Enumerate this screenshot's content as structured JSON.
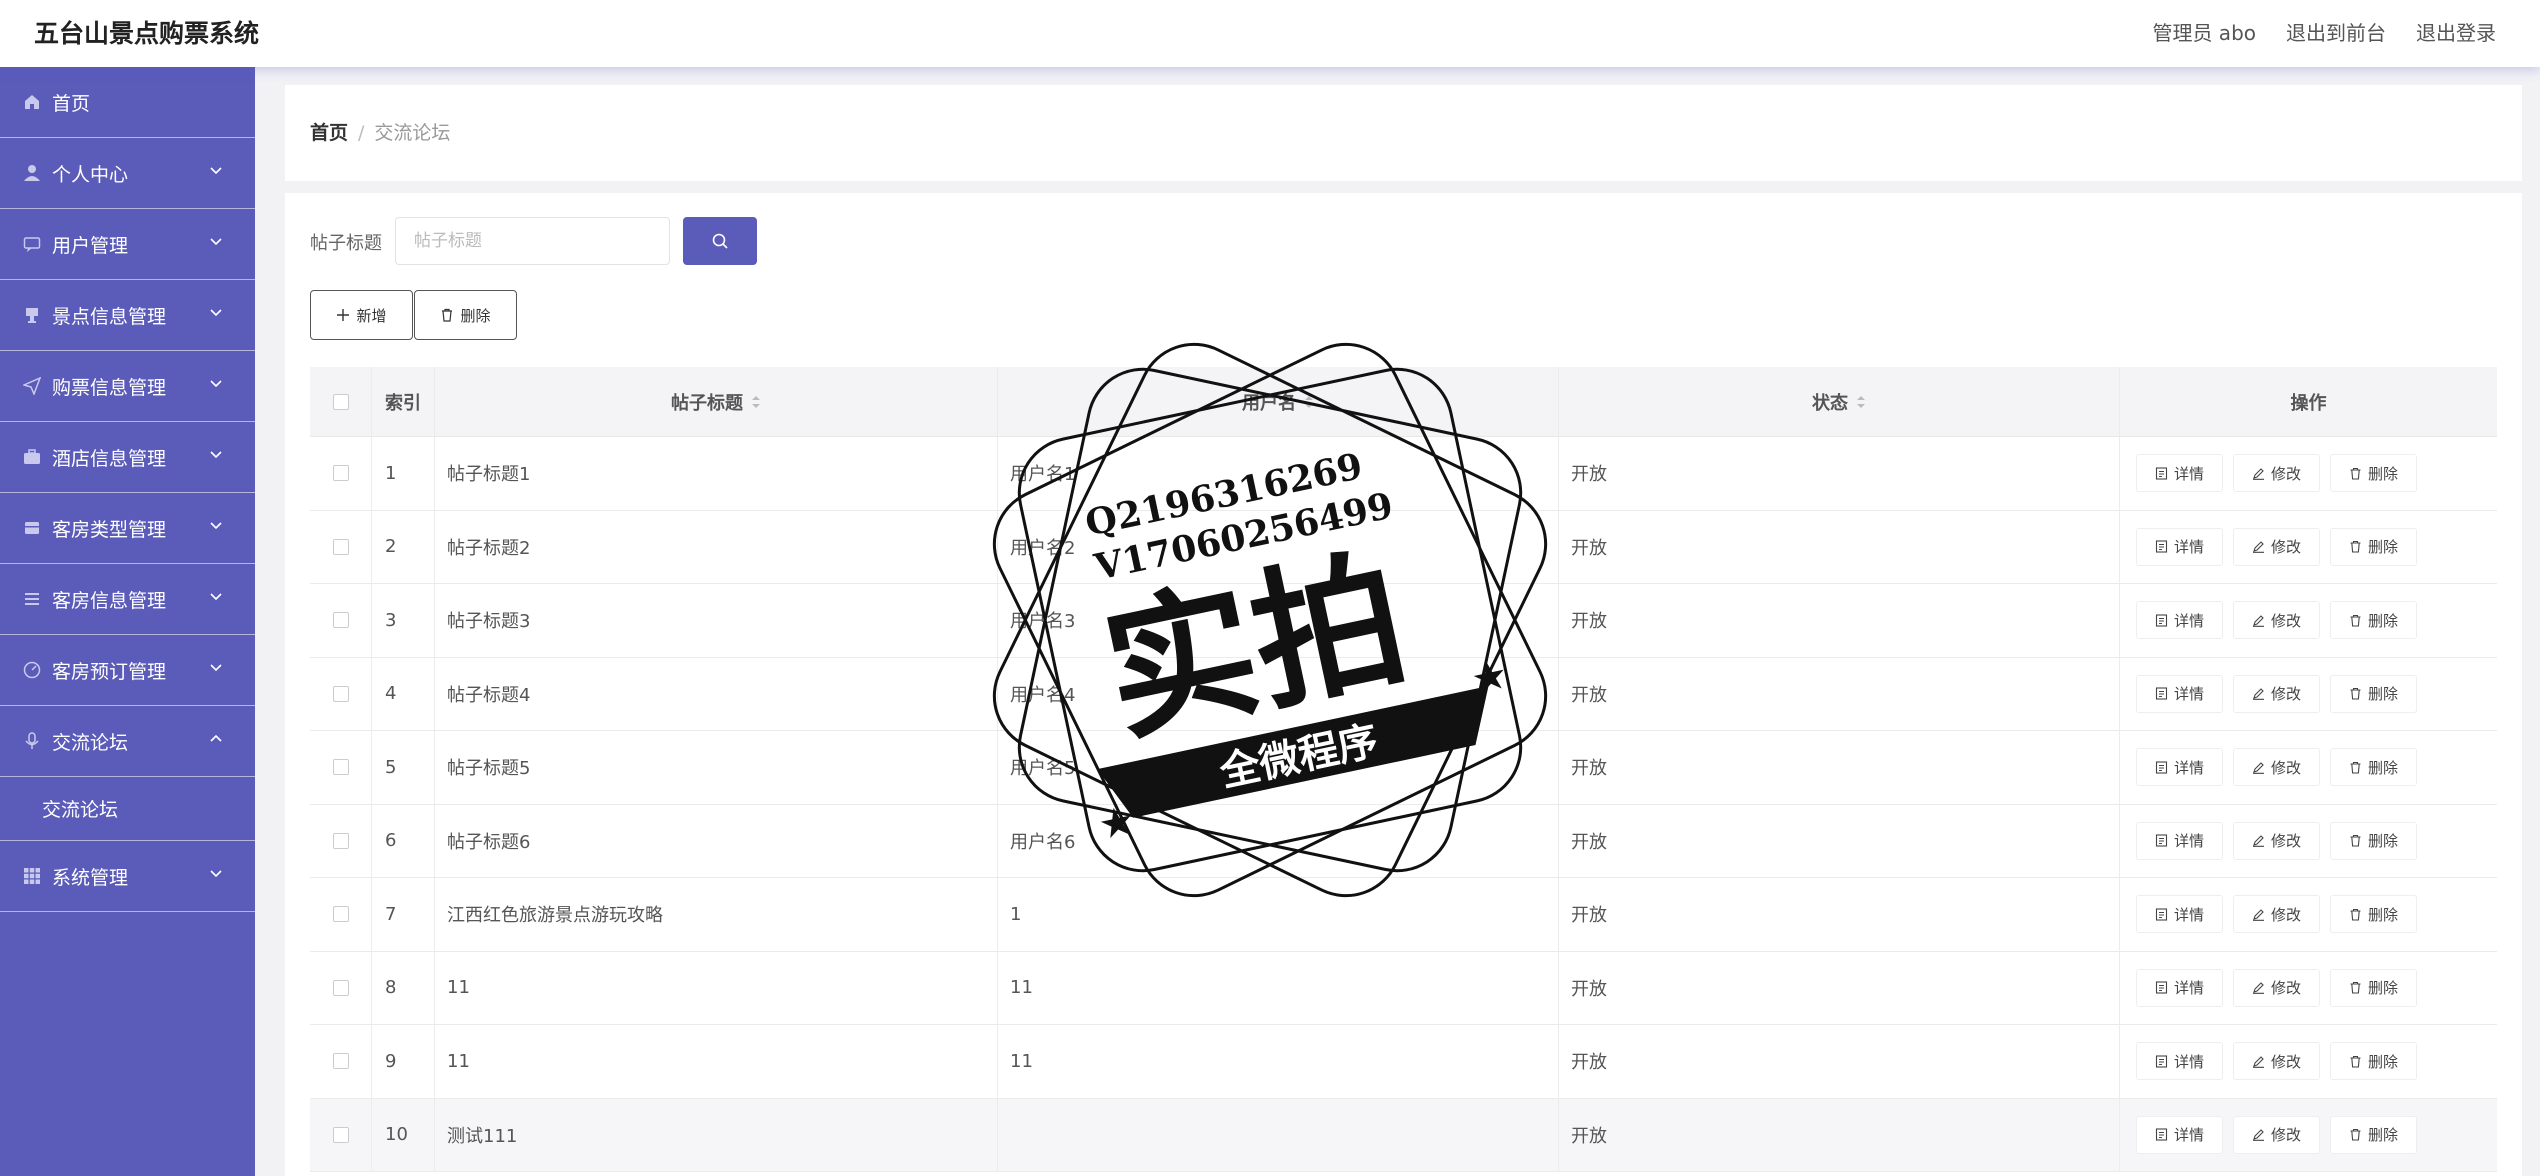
{
  "header": {
    "app_title": "五台山景点购票系统",
    "admin": "管理员 abo",
    "to_front": "退出到前台",
    "logout": "退出登录"
  },
  "sidebar": {
    "items": [
      {
        "label": "首页",
        "icon": "home-icon"
      },
      {
        "label": "个人中心",
        "icon": "user-icon"
      },
      {
        "label": "用户管理",
        "icon": "chat-icon"
      },
      {
        "label": "景点信息管理",
        "icon": "cup-icon"
      },
      {
        "label": "购票信息管理",
        "icon": "send-icon"
      },
      {
        "label": "酒店信息管理",
        "icon": "suitcase-icon"
      },
      {
        "label": "客房类型管理",
        "icon": "box-icon"
      },
      {
        "label": "客房信息管理",
        "icon": "list-icon"
      },
      {
        "label": "客房预订管理",
        "icon": "dashboard-icon"
      },
      {
        "label": "交流论坛",
        "icon": "mic-icon"
      },
      {
        "label": "系统管理",
        "icon": "grid-icon"
      }
    ],
    "sub_forum": "交流论坛"
  },
  "breadcrumb": {
    "home": "首页",
    "current": "交流论坛"
  },
  "search": {
    "label": "帖子标题",
    "placeholder": "帖子标题"
  },
  "toolbar": {
    "add_label": "新增",
    "delete_label": "删除"
  },
  "table": {
    "columns": {
      "index": "索引",
      "title": "帖子标题",
      "user": "用户名",
      "status": "状态",
      "ops": "操作"
    },
    "op_labels": {
      "detail": "详情",
      "edit": "修改",
      "delete": "删除"
    },
    "rows": [
      {
        "index": "1",
        "title": "帖子标题1",
        "user": "用户名1",
        "status": "开放"
      },
      {
        "index": "2",
        "title": "帖子标题2",
        "user": "用户名2",
        "status": "开放"
      },
      {
        "index": "3",
        "title": "帖子标题3",
        "user": "用户名3",
        "status": "开放"
      },
      {
        "index": "4",
        "title": "帖子标题4",
        "user": "用户名4",
        "status": "开放"
      },
      {
        "index": "5",
        "title": "帖子标题5",
        "user": "用户名5",
        "status": "开放"
      },
      {
        "index": "6",
        "title": "帖子标题6",
        "user": "用户名6",
        "status": "开放"
      },
      {
        "index": "7",
        "title": "江西红色旅游景点游玩攻略",
        "user": "1",
        "status": "开放"
      },
      {
        "index": "8",
        "title": "11",
        "user": "11",
        "status": "开放"
      },
      {
        "index": "9",
        "title": "11",
        "user": "11",
        "status": "开放"
      },
      {
        "index": "10",
        "title": "测试111",
        "user": "",
        "status": "开放"
      }
    ]
  },
  "watermark": {
    "line1": "Q2196316269",
    "line2": "V17060256499",
    "big": "实拍",
    "banner": "全微程序"
  }
}
